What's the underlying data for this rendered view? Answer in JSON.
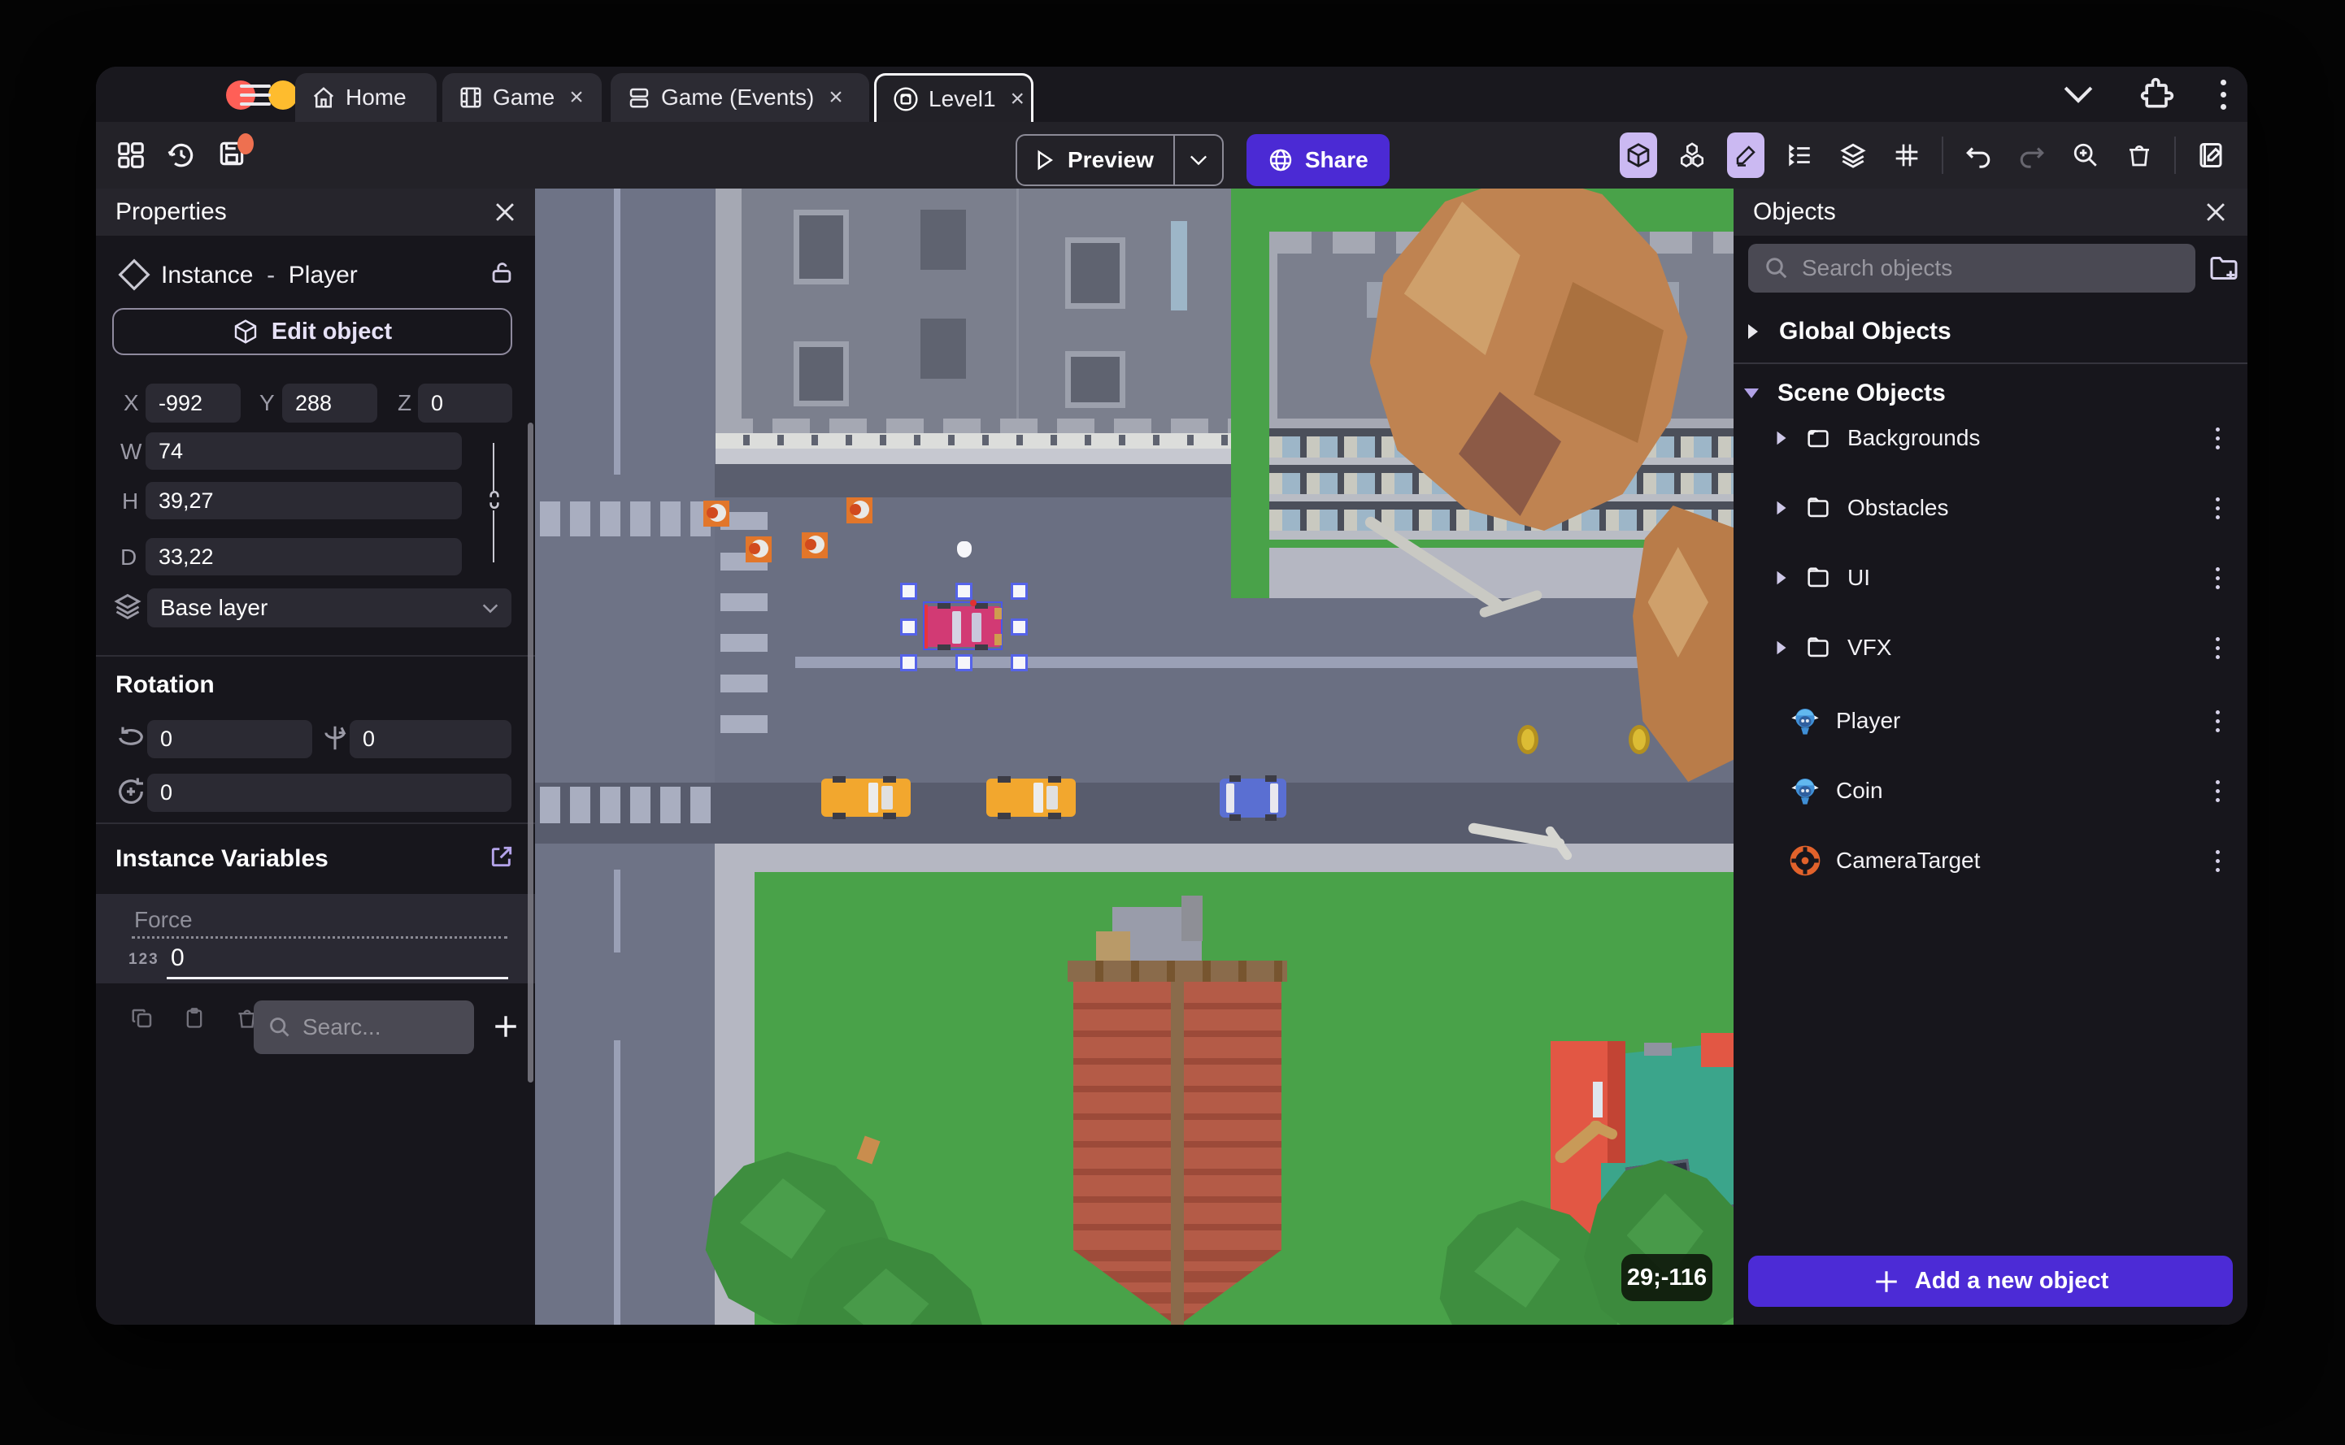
{
  "window": {
    "tabs": [
      {
        "label": "Home"
      },
      {
        "label": "Game"
      },
      {
        "label": "Game (Events)"
      },
      {
        "label": "Level1"
      }
    ],
    "close_glyph": "×",
    "toolbar": {
      "preview_label": "Preview",
      "share_label": "Share"
    }
  },
  "properties_panel": {
    "title": "Properties",
    "instance_label": "Instance",
    "separator": "-",
    "instance_name": "Player",
    "edit_object_label": "Edit object",
    "x_label": "X",
    "x_value": "-992",
    "y_label": "Y",
    "y_value": "288",
    "z_label": "Z",
    "z_value": "0",
    "w_label": "W",
    "w_value": "74",
    "h_label": "H",
    "h_value": "39,27",
    "d_label": "D",
    "d_value": "33,22",
    "layer_value": "Base layer",
    "rotation_title": "Rotation",
    "rot_x_value": "0",
    "rot_y_value": "0",
    "rot_z_value": "0",
    "variables_title": "Instance Variables",
    "variable_name": "Force",
    "variable_type_badge": "123",
    "variable_value": "0",
    "search_placeholder": "Searc..."
  },
  "objects_panel": {
    "title": "Objects",
    "search_placeholder": "Search objects",
    "global_group_label": "Global Objects",
    "scene_group_label": "Scene Objects",
    "folders": [
      {
        "label": "Backgrounds"
      },
      {
        "label": "Obstacles"
      },
      {
        "label": "UI"
      },
      {
        "label": "VFX"
      }
    ],
    "objects": [
      {
        "label": "Player"
      },
      {
        "label": "Coin"
      },
      {
        "label": "CameraTarget"
      }
    ],
    "add_button_label": "Add a new object"
  },
  "canvas": {
    "cursor_coordinates": "29;-116"
  },
  "colors": {
    "accent_purple": "#4b2ad4",
    "active_tool_bg": "#cbb9f2",
    "grass": "#49a249",
    "road": "#6a6f82",
    "selection": "#5563e8"
  }
}
